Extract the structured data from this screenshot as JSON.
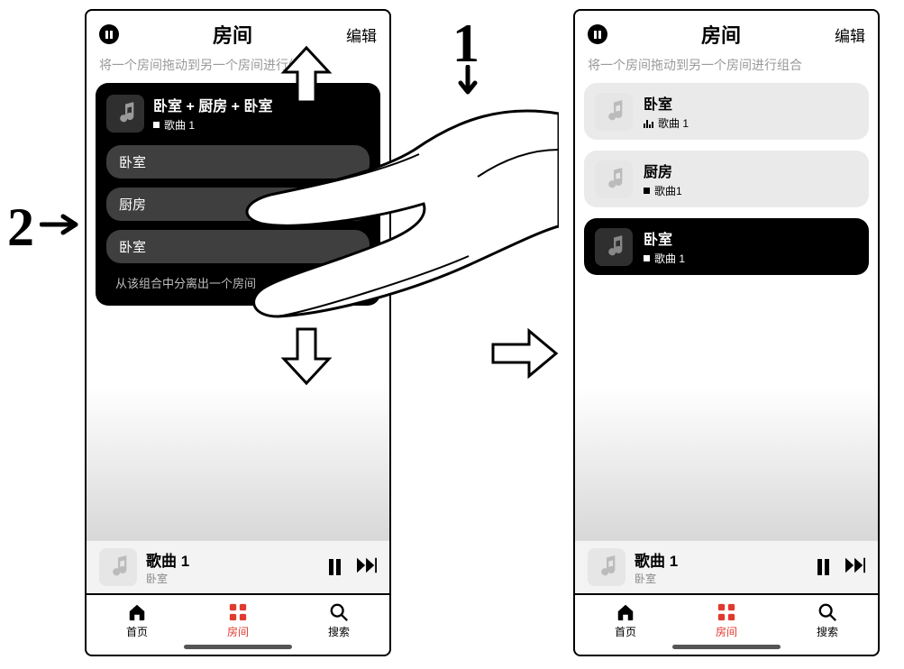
{
  "annotations": {
    "step1": "1",
    "step2": "2"
  },
  "header": {
    "title": "房间",
    "edit": "编辑",
    "hint": "将一个房间拖动到另一个房间进行组合"
  },
  "left": {
    "group_title": "卧室 + 厨房 + 卧室",
    "group_sub": "歌曲 1",
    "rooms": [
      "卧室",
      "厨房",
      "卧室"
    ],
    "group_footer": "从该组合中分离出一个房间"
  },
  "right": {
    "rows": [
      {
        "title": "卧室",
        "sub": "歌曲 1",
        "indicator": "bars",
        "active": false
      },
      {
        "title": "厨房",
        "sub": "歌曲1",
        "indicator": "dot",
        "active": false
      },
      {
        "title": "卧室",
        "sub": "歌曲 1",
        "indicator": "dot",
        "active": true
      }
    ]
  },
  "nowplaying": {
    "title": "歌曲 1",
    "sub": "卧室"
  },
  "tabs": {
    "home": "首页",
    "rooms": "房间",
    "search": "搜索"
  },
  "icons": {
    "pause": "pause-icon",
    "music": "music-note-icon",
    "next": "next-track-icon",
    "home": "home-icon",
    "grid": "grid-icon",
    "search": "search-icon"
  }
}
